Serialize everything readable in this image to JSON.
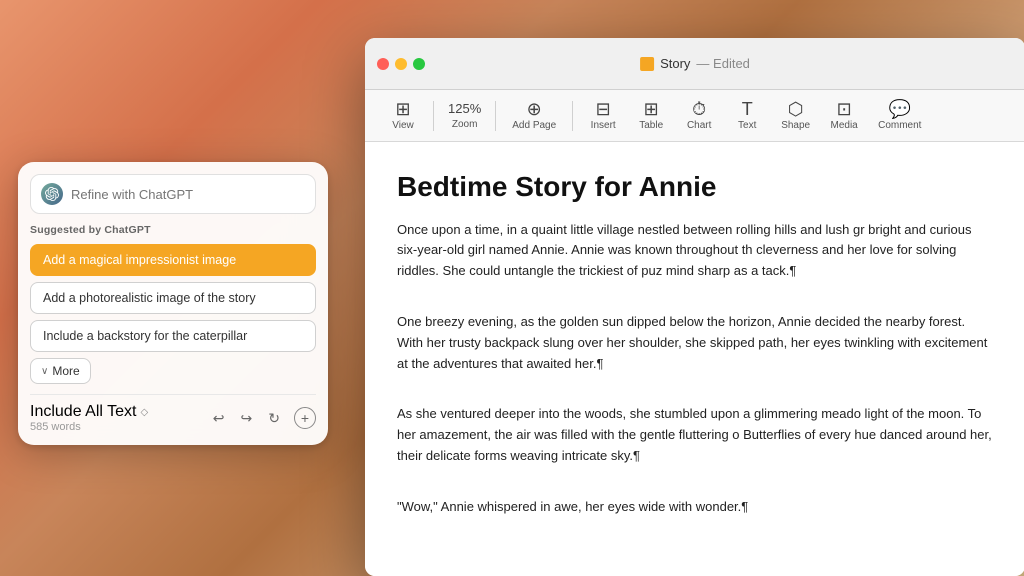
{
  "desktop": {
    "bg_description": "macOS Monterey gradient desktop"
  },
  "pages_window": {
    "title": "Story",
    "title_suffix": "— Edited",
    "traffic_lights": [
      "close",
      "minimize",
      "maximize"
    ],
    "toolbar": {
      "view_label": "View",
      "zoom_value": "125%",
      "zoom_label": "Zoom",
      "add_page_label": "Add Page",
      "insert_label": "Insert",
      "table_label": "Table",
      "chart_label": "Chart",
      "text_label": "Text",
      "shape_label": "Shape",
      "media_label": "Media",
      "comment_label": "Comment"
    },
    "document": {
      "title": "Bedtime Story for Annie",
      "paragraphs": [
        "Once upon a time, in a quaint little village nestled between rolling hills and lush gr bright and curious six-year-old girl named Annie. Annie was known throughout th cleverness and her love for solving riddles. She could untangle the trickiest of puz mind sharp as a tack.¶",
        "",
        "One breezy evening, as the golden sun dipped below the horizon, Annie decided the nearby forest. With her trusty backpack slung over her shoulder, she skipped path, her eyes twinkling with excitement at the adventures that awaited her.¶",
        "",
        "As she ventured deeper into the woods, she stumbled upon a glimmering meado light of the moon. To her amazement, the air was filled with the gentle fluttering o Butterflies of every hue danced around her, their delicate forms weaving intricate sky.¶",
        "",
        "\"Wow,\" Annie whispered in awe, her eyes wide with wonder.¶",
        ""
      ]
    }
  },
  "chatgpt_panel": {
    "refine_placeholder": "Refine with ChatGPT",
    "suggested_label": "Suggested by ChatGPT",
    "suggestions": [
      {
        "text": "Add a magical impressionist image",
        "active": true
      },
      {
        "text": "Add a photorealistic image of the story",
        "active": false
      },
      {
        "text": "Include a backstory for the caterpillar",
        "active": false
      }
    ],
    "more_label": "More",
    "footer": {
      "include_label": "Include All Text",
      "arrows": "◇",
      "word_count": "585 words"
    },
    "actions": {
      "undo": "↩",
      "redo": "↪",
      "refresh": "↻",
      "add": "+"
    }
  }
}
